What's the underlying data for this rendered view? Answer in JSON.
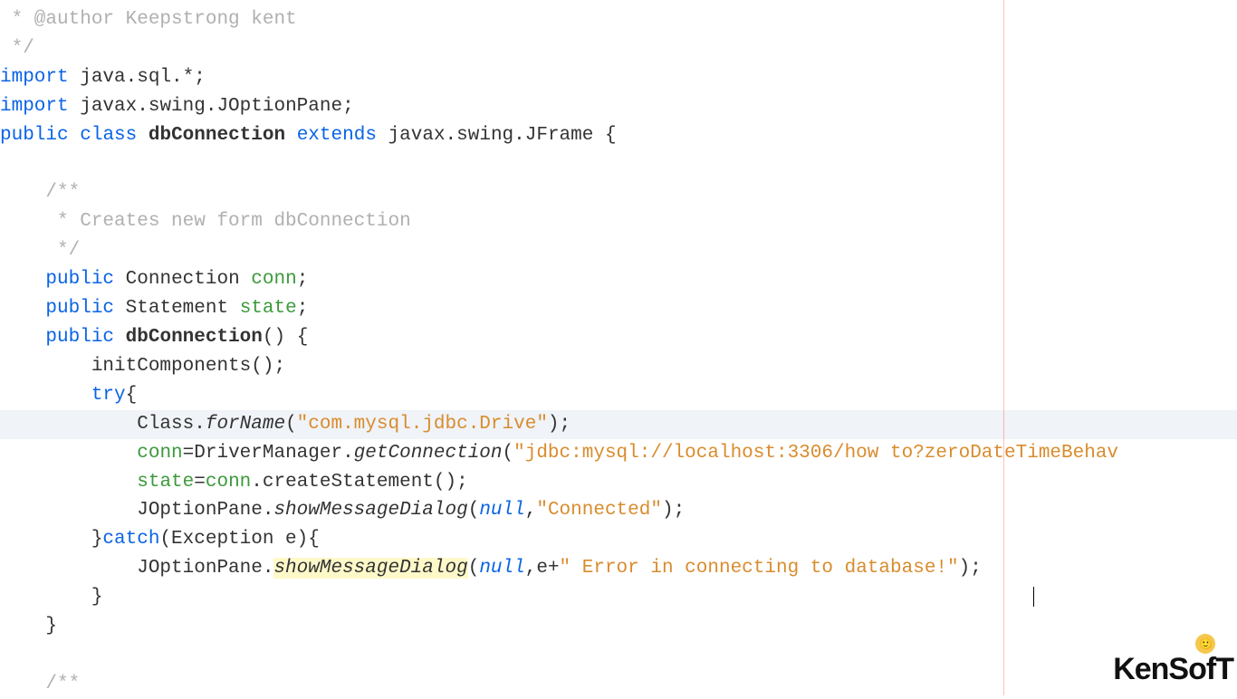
{
  "author_comment": " * @author Keepstrong kent",
  "end_comment": " */",
  "import1_kw": "import",
  "import1_rest": " java.sql.*;",
  "import2_kw": "import",
  "import2_rest": " javax.swing.JOptionPane;",
  "class_kw_public": "public",
  "class_kw_class": "class",
  "class_name": "dbConnection",
  "class_kw_extends": "extends",
  "class_superclass": "javax.swing.JFrame {",
  "doc_open": "    /**",
  "doc_body": "     * Creates new form dbConnection",
  "doc_close": "     */",
  "field1_kw": "public",
  "field1_type": "Connection",
  "field1_name": "conn",
  "field2_kw": "public",
  "field2_type": "Statement",
  "field2_name": "state",
  "ctor_kw": "public",
  "ctor_name": "dbConnection",
  "ctor_open": "() {",
  "init_call": "        initComponents();",
  "try_kw": "try",
  "try_brace": "{",
  "cls_forname_prefix": "            Class.",
  "cls_forname_method": "forName",
  "cls_forname_open": "(",
  "cls_forname_str": "\"com.mysql.jdbc.Drive\"",
  "cls_forname_close": ");",
  "conn_assign_field": "conn",
  "conn_assign_eq": "=DriverManager.",
  "conn_assign_method": "getConnection",
  "conn_assign_open": "(",
  "conn_assign_str": "\"jdbc:mysql://localhost:3306/how to?zeroDateTimeBehav",
  "state_assign_field": "state",
  "state_assign_eq": "=",
  "state_assign_conn": "conn",
  "state_assign_rest": ".createStatement();",
  "jop1_prefix": "            JOptionPane.",
  "jop1_method": "showMessageDialog",
  "jop1_open": "(",
  "jop1_null": "null",
  "jop1_comma": ",",
  "jop1_str": "\"Connected\"",
  "jop1_close": ");",
  "catch_close_try": "        }",
  "catch_kw": "catch",
  "catch_params": "(Exception e){",
  "jop2_prefix": "            JOptionPane.",
  "jop2_method": "showMessageDialog",
  "jop2_open": "(",
  "jop2_null": "null",
  "jop2_comma": ",e+",
  "jop2_str": "\" Error in connecting to database!\"",
  "jop2_close": ");",
  "close_catch": "        }",
  "close_ctor": "    }",
  "doc2_open": "    /**",
  "logo_text": "KenSofT"
}
